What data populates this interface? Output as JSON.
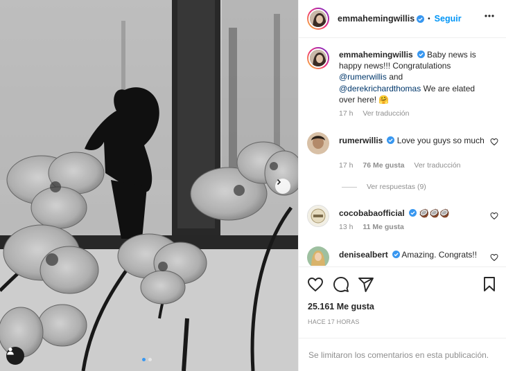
{
  "post": {
    "author": "emmahemingwillis",
    "follow_separator": "•",
    "follow_label": "Seguir",
    "caption_text": "Baby news is happy news!!! Congratulations",
    "caption_mention_1": "@rumerwillis",
    "caption_and": "and",
    "caption_mention_2": "@derekrichardthomas",
    "caption_end": "We are elated over here!",
    "caption_emoji": "🤗",
    "caption_time": "17 h",
    "caption_translate": "Ver traducción",
    "likes": "25.161 Me gusta",
    "time_ago": "HACE 17 HORAS",
    "comments_limited": "Se limitaron los comentarios en esta publicación."
  },
  "comments": [
    {
      "user": "rumerwillis",
      "text": "Love you guys so much",
      "time": "17 h",
      "likes": "76 Me gusta",
      "translate": "Ver traducción",
      "replies": "Ver respuestas (9)"
    },
    {
      "user": "cocobabaofficial",
      "text": "🥥🥥🥥",
      "time": "13 h",
      "likes": "11 Me gusta"
    },
    {
      "user": "denisealbert",
      "text": "Amazing. Congrats!!"
    }
  ],
  "icons": {
    "verified": "verified-badge-icon",
    "more": "more-options-icon",
    "heart": "heart-icon",
    "comment": "comment-icon",
    "share": "share-icon",
    "save": "save-bookmark-icon",
    "next": "chevron-right-icon",
    "tag": "user-tag-icon"
  },
  "colors": {
    "accent": "#0095f6",
    "verified": "#3897f0",
    "mention": "#00376b",
    "muted": "#8e8e8e"
  },
  "carousel": {
    "count": 2,
    "current": 1
  }
}
